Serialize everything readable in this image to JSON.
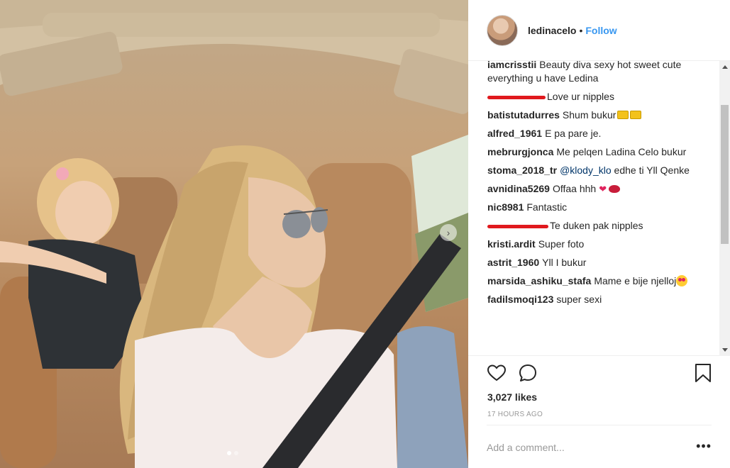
{
  "header": {
    "username": "ledinacelo",
    "separator": "•",
    "follow_label": "Follow"
  },
  "comments": [
    {
      "user": "iamcrisstii",
      "text": "Beauty diva sexy hot sweet cute everything u have Ledina",
      "censored": false
    },
    {
      "user": "",
      "text": "Love ur nipples",
      "censored": true
    },
    {
      "user": "batistutadurres",
      "text": "Shum bukur",
      "censored": false,
      "emoji": [
        "crown-icon",
        "crown-icon"
      ]
    },
    {
      "user": "alfred_1961",
      "text": "E pa pare je.",
      "censored": false
    },
    {
      "user": "mebrurgjonca",
      "text": "Me pelqen Ladina Celo bukur",
      "censored": false
    },
    {
      "user": "stoma_2018_tr",
      "mention": "@klody_klo",
      "text": "edhe ti Yll Qenke",
      "censored": false
    },
    {
      "user": "avnidina5269",
      "text": "Offaa hhh",
      "censored": false,
      "emoji": [
        "heart-icon",
        "lips-icon"
      ]
    },
    {
      "user": "nic8981",
      "text": "Fantastic",
      "censored": false
    },
    {
      "user": "",
      "text": "Te duken pak nipples",
      "censored": true
    },
    {
      "user": "kristi.ardit",
      "text": "Super foto",
      "censored": false
    },
    {
      "user": "astrit_1960",
      "text": "Yll I bukur",
      "censored": false
    },
    {
      "user": "marsida_ashiku_stafa",
      "text": "Mame e bije njelloj",
      "censored": false,
      "emoji": [
        "star-struck-icon"
      ]
    },
    {
      "user": "fadilsmoqi123",
      "text": "super sexi",
      "censored": false
    }
  ],
  "post": {
    "likes": "3,027 likes",
    "time": "17 HOURS AGO",
    "comment_placeholder": "Add a comment...",
    "more_label": "•••"
  },
  "carousel": {
    "next_label": "›",
    "slide_count": 2,
    "active_slide": 1
  },
  "colors": {
    "follow": "#3897f0",
    "censor_scribble": "#e0191e",
    "text": "#262626",
    "muted": "#999999"
  }
}
